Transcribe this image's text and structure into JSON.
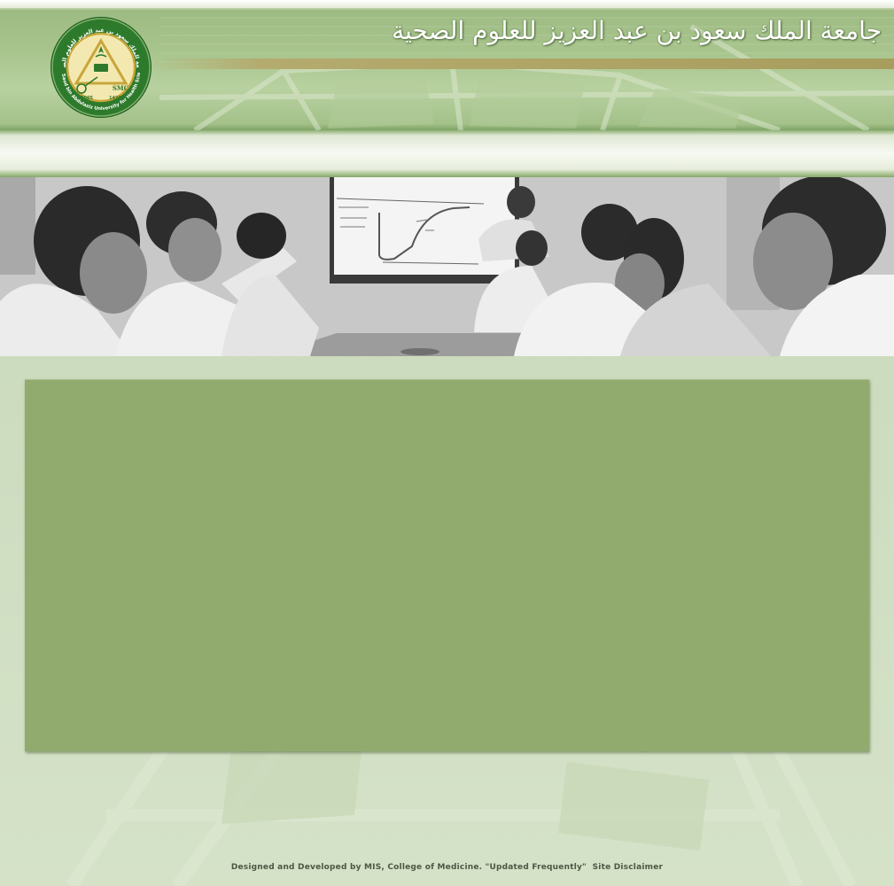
{
  "header": {
    "title_arabic": "جامعة الملك سعود بن عبد العزيز للعلوم الصحية",
    "logo_icon": "university-seal-icon",
    "logo_arabic_text": "جامعة الملك سعود بن عبد العزيز للعلوم الصحية",
    "logo_english_text": "King Saud bin Abdulaziz University for Health Sciences",
    "logo_year_left": "2005",
    "logo_year_right": "1426",
    "logo_initials": "SMC"
  },
  "banner": {
    "image_icon": "classroom-photo-icon"
  },
  "content": {},
  "footer": {
    "credit": "Designed and Developed by MIS, College of Medicine. \"Updated Frequently\"",
    "disclaimer_link": "Site Disclaimer"
  },
  "colors": {
    "header_green": "#a9c58e",
    "panel_green": "#91ab6f",
    "page_background": "#c9d8b8",
    "logo_green": "#2e7a2c",
    "logo_gold": "#c9a53a",
    "footer_text": "#4d5744"
  }
}
